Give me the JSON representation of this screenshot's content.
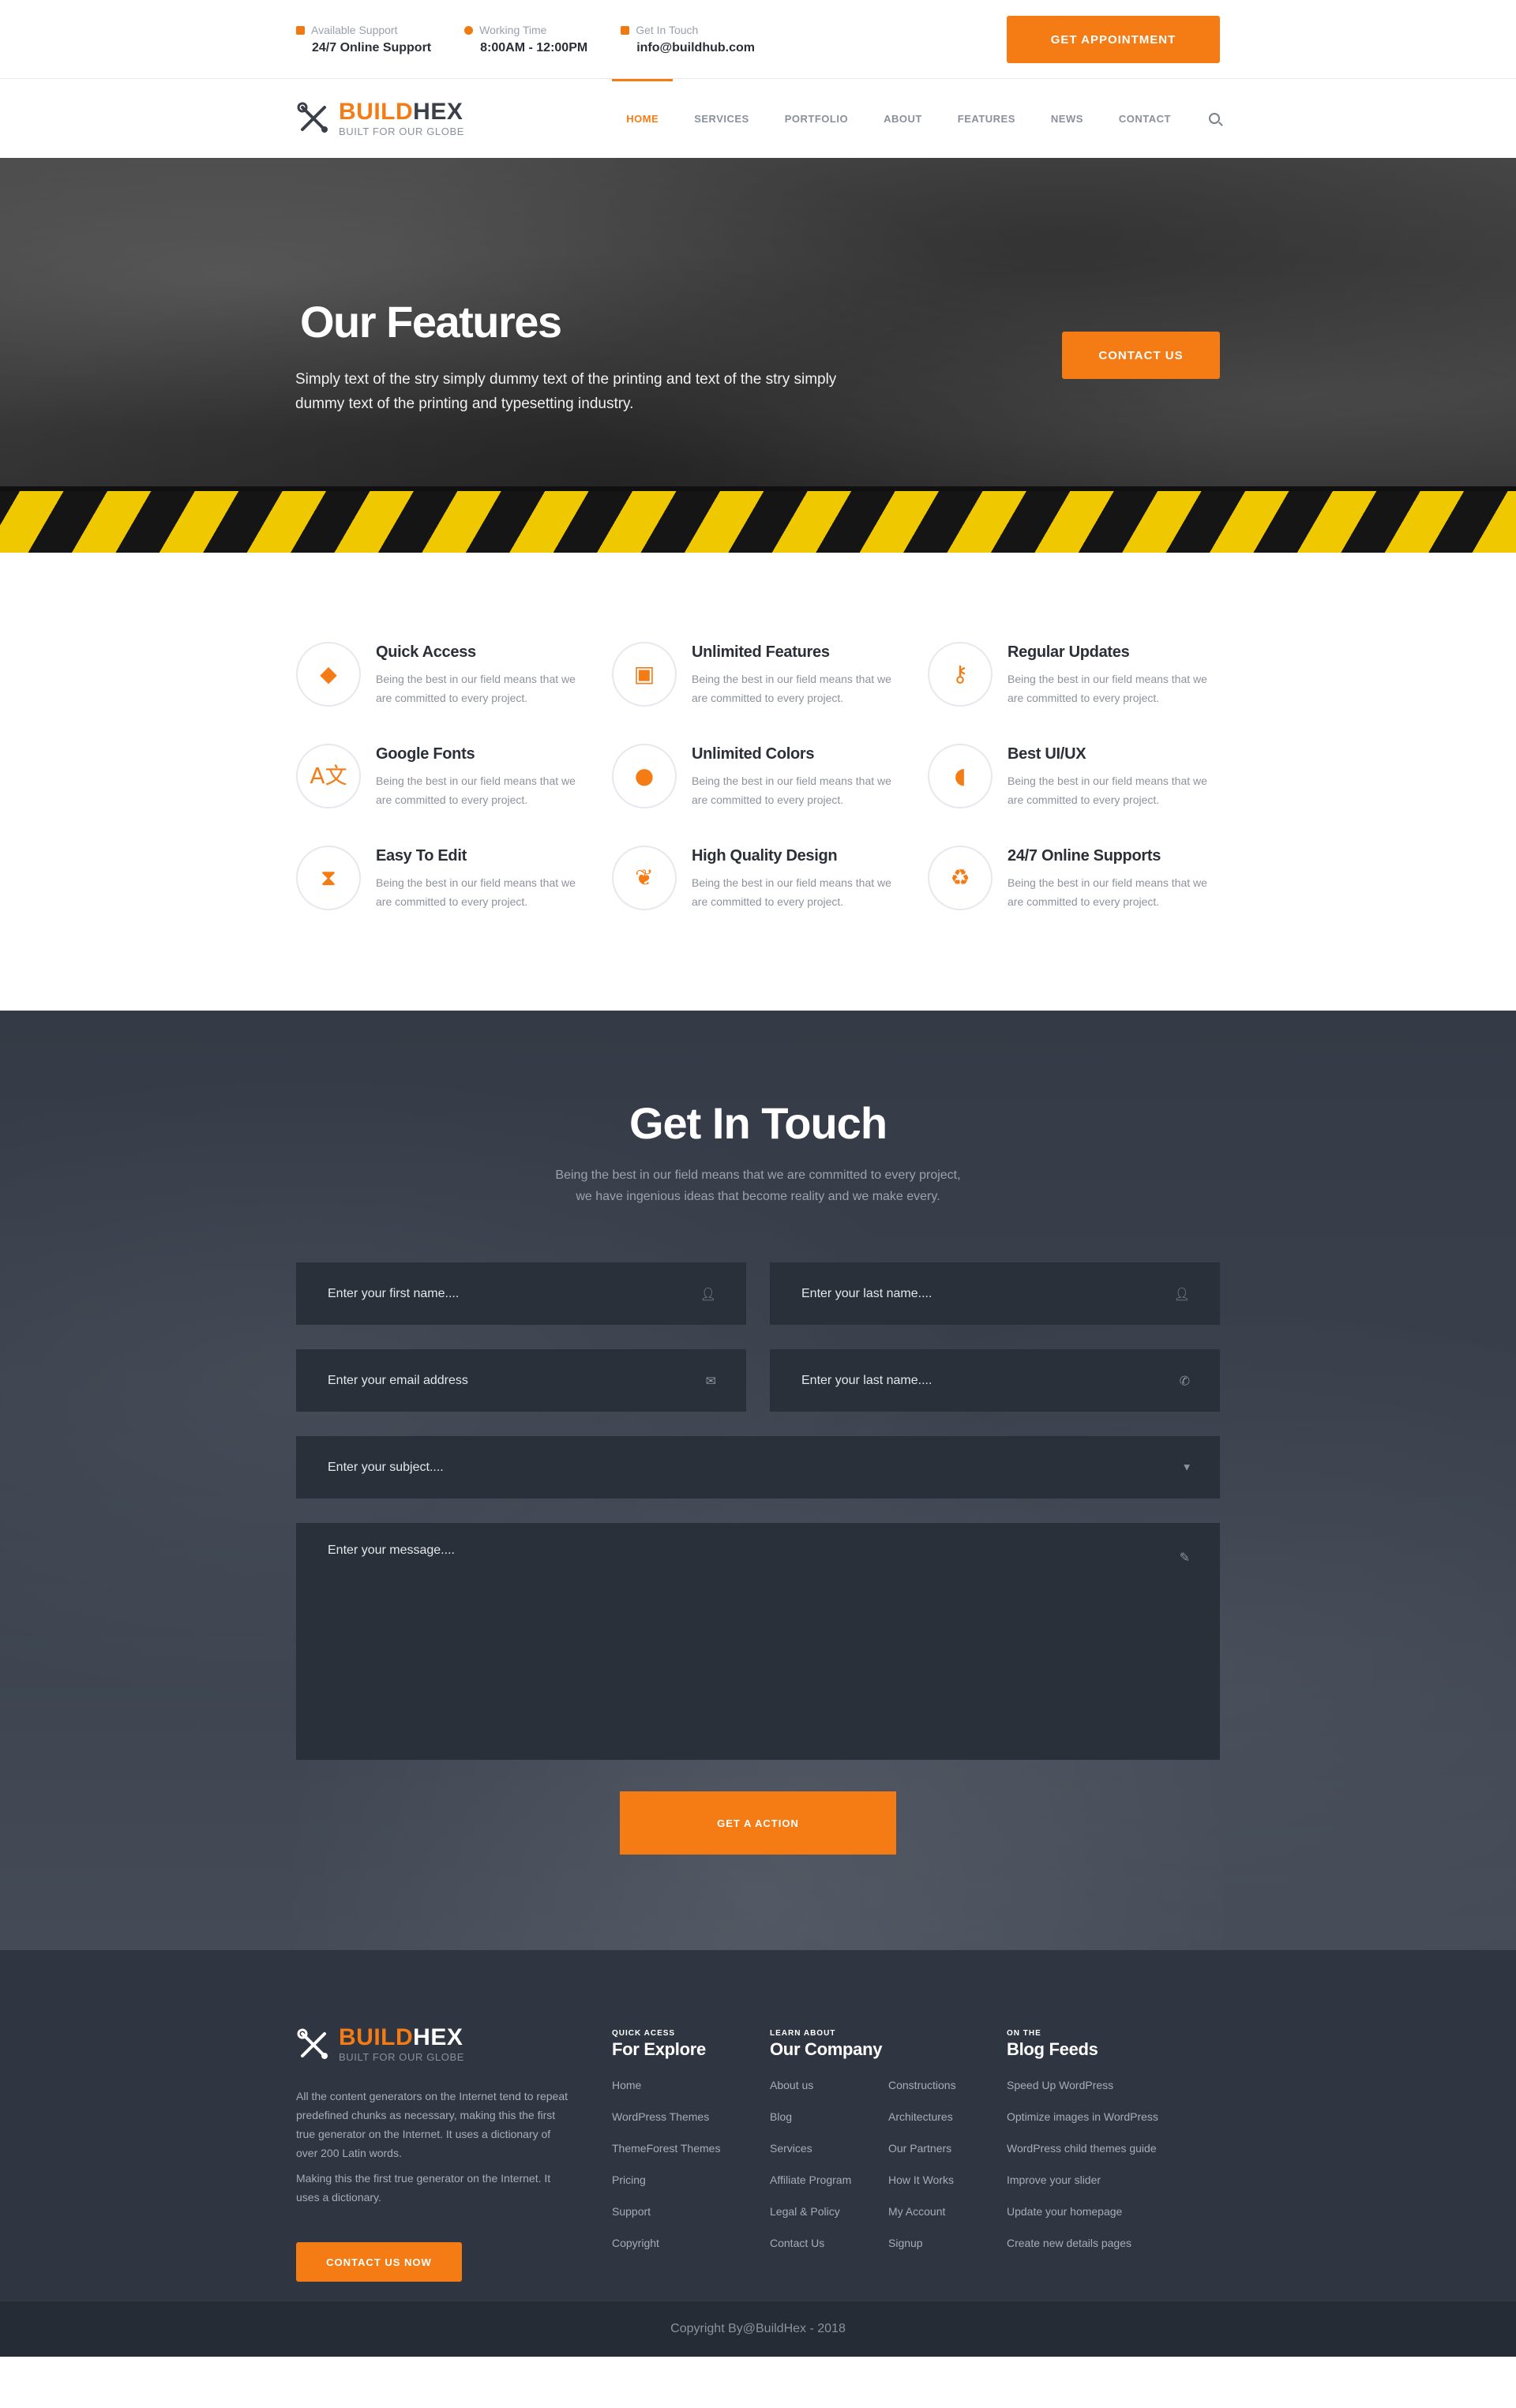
{
  "topbar": {
    "support_label": "Available Support",
    "support_value": "24/7 Online Support",
    "time_label": "Working Time",
    "time_value": "8:00AM - 12:00PM",
    "touch_label": "Get In Touch",
    "touch_value": "info@buildhub.com",
    "appointment_button": "GET APPOINTMENT"
  },
  "brand": {
    "name_part1": "BUILD",
    "name_part2": "HEX",
    "tagline": "BUILT FOR OUR GLOBE"
  },
  "nav": {
    "items": [
      "HOME",
      "SERVICES",
      "PORTFOLIO",
      "ABOUT",
      "FEATURES",
      "NEWS",
      "CONTACT"
    ],
    "active": "HOME",
    "search_icon": "search-icon"
  },
  "hero": {
    "title": "Our Features",
    "subtitle": "Simply text of the stry simply dummy text of the printing and text of the stry simply dummy text of the printing and typesetting industry.",
    "contact_button": "CONTACT US"
  },
  "features": [
    {
      "title": "Quick Access",
      "desc": "Being the best in our field means that we are committed to every project.",
      "icon": "diamond-icon",
      "glyph": "◆"
    },
    {
      "title": "Unlimited Features",
      "desc": "Being the best in our field means that we are committed to every project.",
      "icon": "gift-icon",
      "glyph": "▣"
    },
    {
      "title": "Regular Updates",
      "desc": "Being the best in our field means that we are committed to every project.",
      "icon": "key-icon",
      "glyph": "⚷"
    },
    {
      "title": "Google Fonts",
      "desc": "Being the best in our field means that we are committed to every project.",
      "icon": "translate-icon",
      "glyph": "A文"
    },
    {
      "title": "Unlimited Colors",
      "desc": "Being the best in our field means that we are committed to every project.",
      "icon": "lightbulb-icon",
      "glyph": "●"
    },
    {
      "title": "Best UI/UX",
      "desc": "Being the best in our field means that we are committed to every project.",
      "icon": "leaf-icon",
      "glyph": "◖"
    },
    {
      "title": "Easy To Edit",
      "desc": "Being the best in our field means that we are committed to every project.",
      "icon": "hourglass-icon",
      "glyph": "⧗"
    },
    {
      "title": "High Quality Design",
      "desc": "Being the best in our field means that we are committed to every project.",
      "icon": "feather-icon",
      "glyph": "❦"
    },
    {
      "title": "24/7 Online Supports",
      "desc": "Being the best in our field means that we are committed to every project.",
      "icon": "recycle-icon",
      "glyph": "♻"
    }
  ],
  "touch": {
    "title": "Get In Touch",
    "lead_line1": "Being the best in our field means that we are committed to every project,",
    "lead_line2": "we have ingenious ideas that become reality and we make every.",
    "first_name": "Enter your first name....",
    "last_name": "Enter your last name....",
    "email": "Enter your email address",
    "phone": "Enter your last name....",
    "subject": "Enter your subject....",
    "message": "Enter your message....",
    "action_button": "GET A ACTION"
  },
  "footer": {
    "desc1": "All the content generators on the Internet tend to repeat predefined chunks as necessary, making this the first true generator on the Internet. It uses a dictionary of over 200 Latin words.",
    "desc2": "Making this the first true generator on the Internet. It uses a dictionary.",
    "contact_button": "CONTACT US NOW",
    "explore": {
      "small": "QUICK ACESS",
      "big": "For Explore",
      "items": [
        "Home",
        "WordPress Themes",
        "ThemeForest Themes",
        "Pricing",
        "Support",
        "Copyright"
      ]
    },
    "company": {
      "small": "LEARN ABOUT",
      "big": "Our Company",
      "items1": [
        "About us",
        "Blog",
        "Services",
        "Affiliate Program",
        "Legal & Policy",
        "Contact Us"
      ],
      "items2": [
        "Constructions",
        "Architectures",
        "Our Partners",
        "How It Works",
        "My Account",
        "Signup"
      ]
    },
    "blog": {
      "small": "ON THE",
      "big": "Blog Feeds",
      "items": [
        "Speed Up WordPress",
        "Optimize images in WordPress",
        "WordPress child themes guide",
        "Improve your slider",
        "Update your homepage",
        "Create new details pages"
      ]
    },
    "copyright": "Copyright By@BuildHex - 2018"
  },
  "colors": {
    "accent": "#f57c14",
    "dark": "#2f3641",
    "stripe_yellow": "#f0c800"
  }
}
